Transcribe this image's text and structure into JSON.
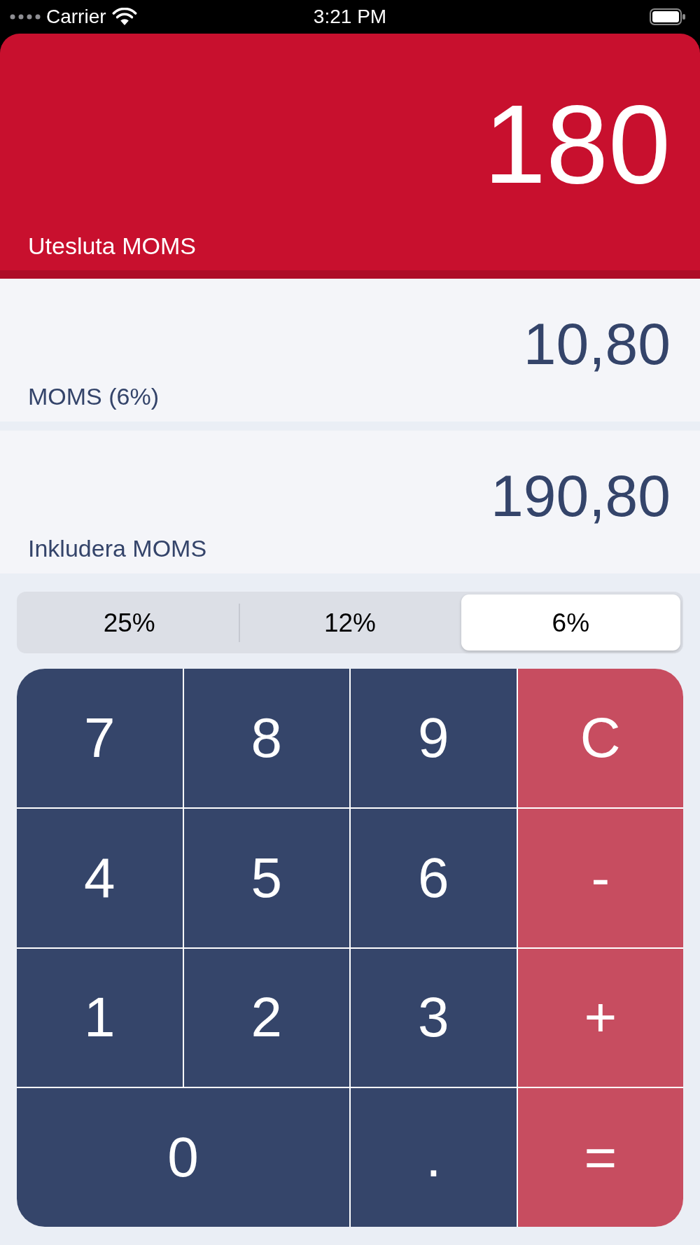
{
  "status_bar": {
    "carrier": "Carrier",
    "time": "3:21 PM"
  },
  "result": {
    "value": "180",
    "label": "Utesluta MOMS"
  },
  "breakdown": [
    {
      "value": "10,80",
      "label": "MOMS (6%)"
    },
    {
      "value": "190,80",
      "label": "Inkludera MOMS"
    }
  ],
  "rates": [
    {
      "label": "25%",
      "selected": false
    },
    {
      "label": "12%",
      "selected": false
    },
    {
      "label": "6%",
      "selected": true
    }
  ],
  "keys": [
    {
      "label": "7",
      "kind": "digit"
    },
    {
      "label": "8",
      "kind": "digit"
    },
    {
      "label": "9",
      "kind": "digit"
    },
    {
      "label": "C",
      "kind": "operator"
    },
    {
      "label": "4",
      "kind": "digit"
    },
    {
      "label": "5",
      "kind": "digit"
    },
    {
      "label": "6",
      "kind": "digit"
    },
    {
      "label": "-",
      "kind": "operator"
    },
    {
      "label": "1",
      "kind": "digit"
    },
    {
      "label": "2",
      "kind": "digit"
    },
    {
      "label": "3",
      "kind": "digit"
    },
    {
      "label": "+",
      "kind": "operator"
    },
    {
      "label": "0",
      "kind": "wide-digit"
    },
    {
      "label": ".",
      "kind": "digit"
    },
    {
      "label": "=",
      "kind": "operator"
    }
  ]
}
